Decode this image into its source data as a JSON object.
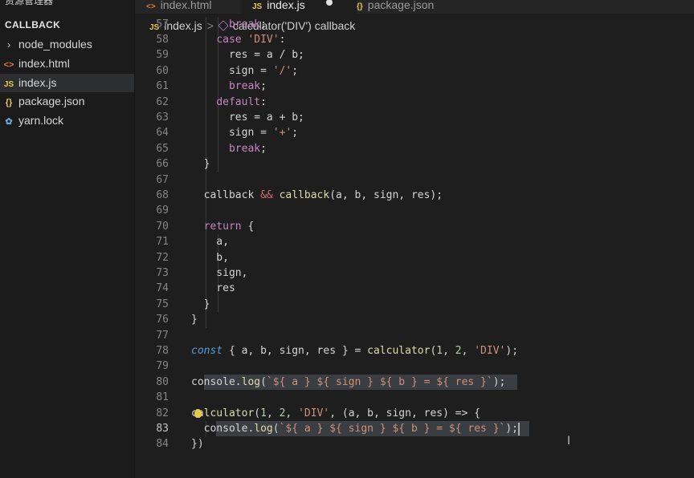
{
  "explorer": {
    "title": "资源管理器",
    "more": "···",
    "section": "CALLBACK",
    "items": [
      {
        "label": "node_modules",
        "icon": "chevron-right",
        "glyph": "›",
        "kind": "folder"
      },
      {
        "label": "index.html",
        "icon": "html-file",
        "glyph": "<>",
        "kind": "html"
      },
      {
        "label": "index.js",
        "icon": "js-file",
        "glyph": "JS",
        "kind": "js",
        "active": true
      },
      {
        "label": "package.json",
        "icon": "json-file",
        "glyph": "{}",
        "kind": "json"
      },
      {
        "label": "yarn.lock",
        "icon": "yarn-file",
        "glyph": "✿",
        "kind": "yarn"
      }
    ]
  },
  "tabs": [
    {
      "label": "index.html",
      "icon": "<>"
    },
    {
      "label": "index.js",
      "icon": "JS",
      "active": true,
      "modified": true
    },
    {
      "label": "package.json",
      "icon": "{}"
    }
  ],
  "breadcrumb": {
    "file_icon": "JS",
    "file": "index.js",
    "separator": ">",
    "symbol": "calculator('DIV') callback"
  },
  "editor": {
    "current_line": 83,
    "lines": [
      {
        "n": 57,
        "text": "        break;"
      },
      {
        "n": 58,
        "text": "      case 'DIV':"
      },
      {
        "n": 59,
        "text": "        res = a / b;"
      },
      {
        "n": 60,
        "text": "        sign = '/';"
      },
      {
        "n": 61,
        "text": "        break;"
      },
      {
        "n": 62,
        "text": "      default:"
      },
      {
        "n": 63,
        "text": "        res = a + b;"
      },
      {
        "n": 64,
        "text": "        sign = '+';"
      },
      {
        "n": 65,
        "text": "        break;"
      },
      {
        "n": 66,
        "text": "    }"
      },
      {
        "n": 67,
        "text": ""
      },
      {
        "n": 68,
        "text": "    callback && callback(a, b, sign, res);"
      },
      {
        "n": 69,
        "text": ""
      },
      {
        "n": 70,
        "text": "    return {"
      },
      {
        "n": 71,
        "text": "      a,"
      },
      {
        "n": 72,
        "text": "      b,"
      },
      {
        "n": 73,
        "text": "      sign,"
      },
      {
        "n": 74,
        "text": "      res"
      },
      {
        "n": 75,
        "text": "    }"
      },
      {
        "n": 76,
        "text": "  }"
      },
      {
        "n": 77,
        "text": ""
      },
      {
        "n": 78,
        "text": "  const { a, b, sign, res } = calculator(1, 2, 'DIV');"
      },
      {
        "n": 79,
        "text": ""
      },
      {
        "n": 80,
        "text": "  console.log(`${ a } ${ sign } ${ b } = ${ res }`);"
      },
      {
        "n": 81,
        "text": ""
      },
      {
        "n": 82,
        "text": "  calculator(1, 2, 'DIV', (a, b, sign, res) => {"
      },
      {
        "n": 83,
        "text": "    console.log(`${ a } ${ sign } ${ b } = ${ res }`);"
      },
      {
        "n": 84,
        "text": "  })"
      }
    ]
  },
  "colors": {
    "background": "#1e1e1e",
    "sidebar": "#1b1b1c",
    "keyword": "#c586c0",
    "string": "#ce9178",
    "number": "#b5cea8",
    "function": "#dcdcaa",
    "const": "#569cd6",
    "line_number": "#858585"
  }
}
